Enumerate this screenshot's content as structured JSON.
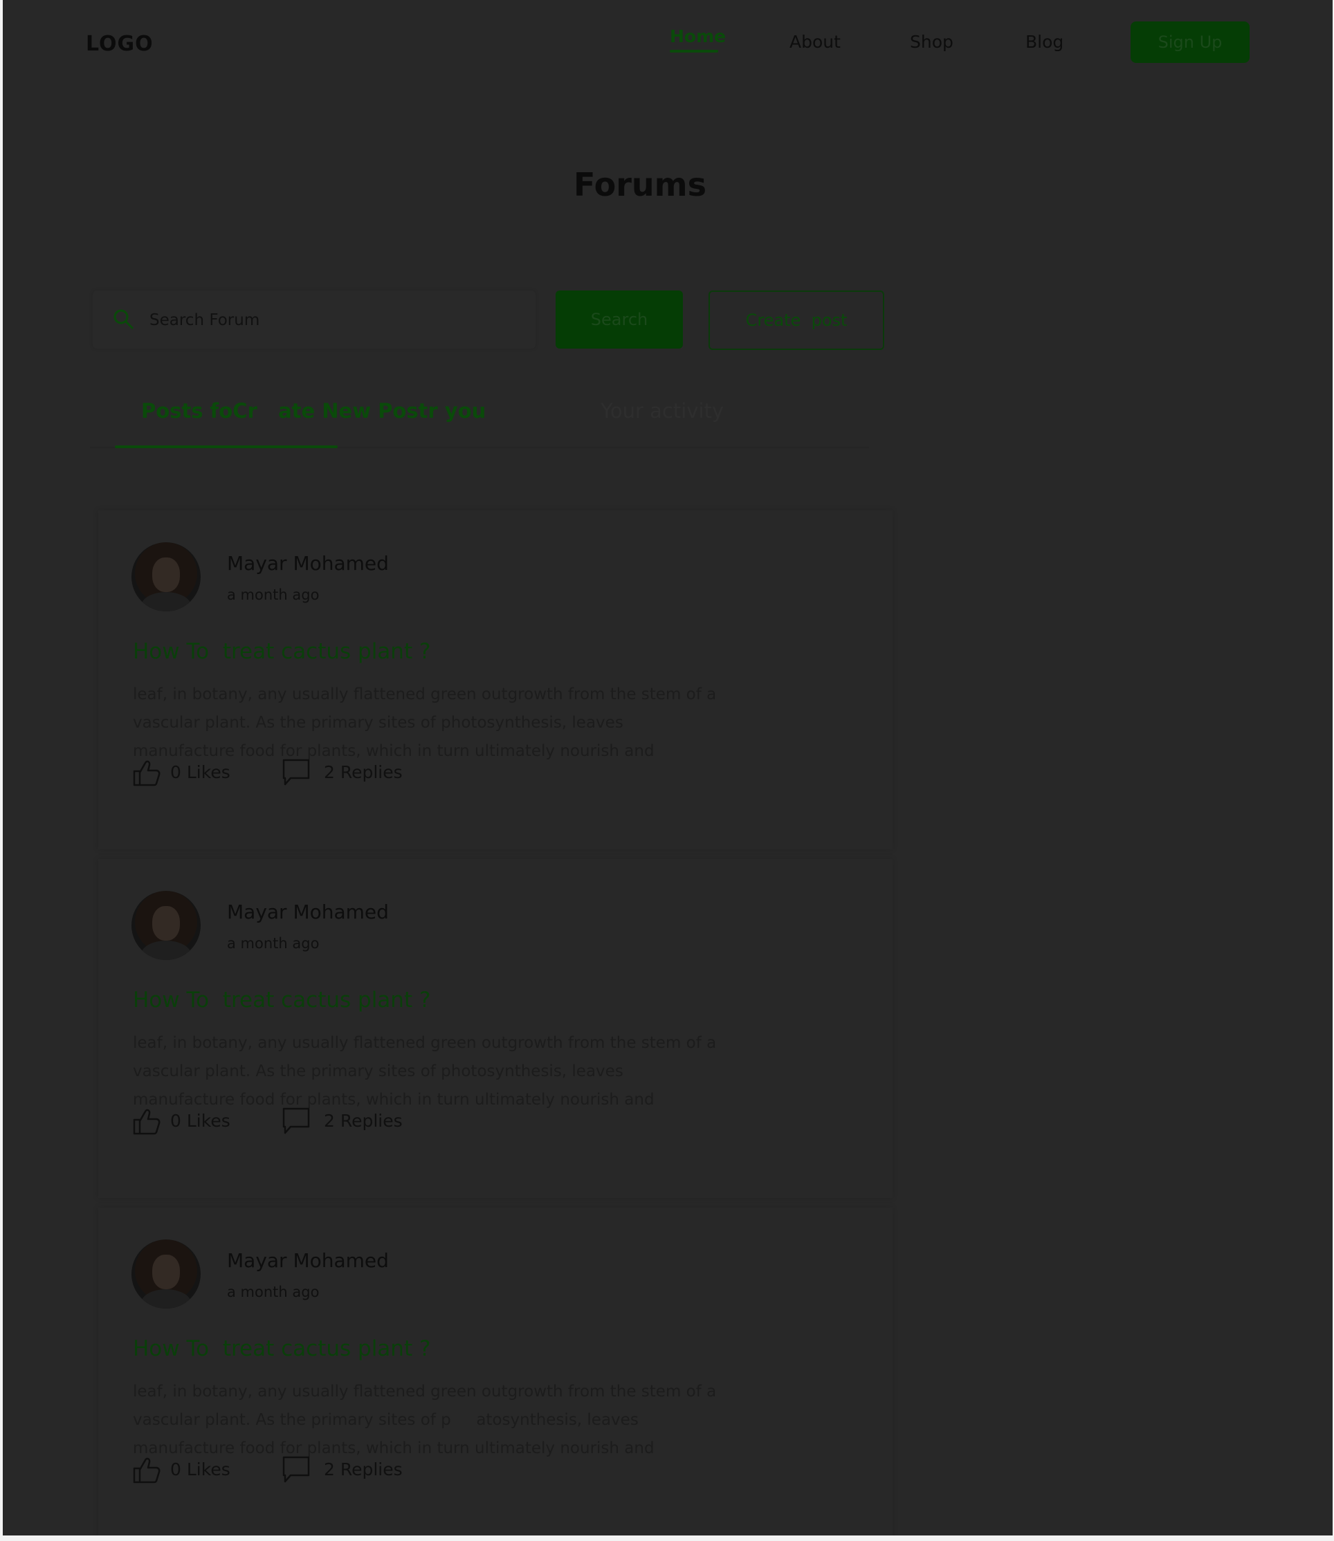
{
  "header": {
    "logo": "LOGO",
    "nav": [
      {
        "label": "Home",
        "active": true
      },
      {
        "label": "About"
      },
      {
        "label": "Shop"
      },
      {
        "label": "Blog"
      }
    ],
    "signup_label": "Sign Up"
  },
  "page_title": "Forums",
  "search": {
    "placeholder": "Search Forum",
    "button_label": "Search",
    "create_label": "Create  post"
  },
  "tabs": [
    {
      "label": "Posts foCr   ate New Postr you",
      "active": true
    },
    {
      "label": "Your activity"
    }
  ],
  "posts": [
    {
      "author": "Mayar Mohamed",
      "time": "a month ago",
      "title": "How To  treat cactus plant ?",
      "excerpt": "leaf, in botany, any usually flattened green outgrowth from the stem of a vascular plant. As the primary sites of photosynthesis, leaves manufacture food for plants, which in turn ultimately nourish and",
      "likes": "0 Likes",
      "replies": "2 Replies"
    },
    {
      "author": "Mayar Mohamed",
      "time": "a month ago",
      "title": "How To  treat cactus plant ?",
      "excerpt": "leaf, in botany, any usually flattened green outgrowth from the stem of a vascular plant. As the primary sites of photosynthesis, leaves manufacture food for plants, which in turn ultimately nourish and",
      "likes": "0 Likes",
      "replies": "2 Replies"
    },
    {
      "author": "Mayar Mohamed",
      "time": "a month ago",
      "title": "How To  treat cactus plant ?",
      "excerpt": "leaf, in botany, any usually flattened green outgrowth from the stem of a vascular plant. As the primary sites of p     atosynthesis, leaves manufacture food for plants, which in turn ultimately nourish and",
      "likes": "0 Likes",
      "replies": "2 Replies"
    }
  ],
  "icons": {
    "search": "search-icon",
    "like": "thumbs-up-icon",
    "reply": "speech-bubble-icon",
    "avatar": "user-avatar"
  },
  "colors": {
    "accent": "#0a4a0a",
    "button": "#053d05",
    "overlay_background": "#282828"
  }
}
